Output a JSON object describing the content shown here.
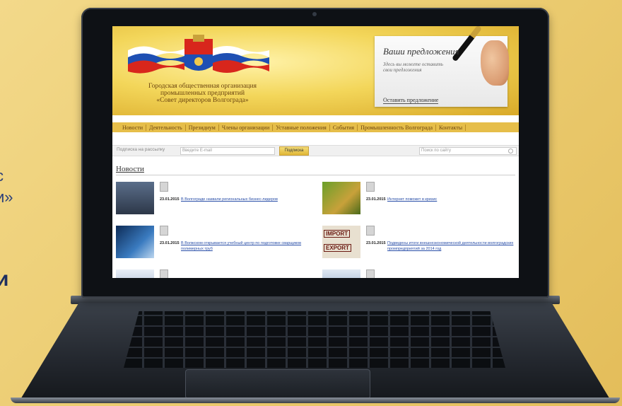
{
  "background_text": {
    "line1": "с",
    "line2": "и»",
    "line3": "и"
  },
  "site": {
    "org_title": [
      "Городская общественная организация",
      "промышленных предприятий",
      "«Совет директоров Волгограда»"
    ],
    "suggestion": {
      "title": "Ваши предложения",
      "subtitle": "Здесь вы можете оставить свои предложения",
      "link": "Оставить предложение"
    },
    "nav": [
      "Новости",
      "Деятельность",
      "Президиум",
      "Члены организации",
      "Уставные положения",
      "События",
      "Промышленность Волгограда",
      "Контакты"
    ],
    "subscribe": {
      "label": "Подписка на рассылку",
      "email_placeholder": "Введите E-mail",
      "button": "Подписка",
      "search_placeholder": "Поиск по сайту"
    },
    "news_heading": "Новости",
    "news": [
      {
        "date": "23.01.2015",
        "title": "В Волгограде назвали региональных бизнес-лидеров"
      },
      {
        "date": "23.01.2015",
        "title": "Интернет поможет в кризис"
      },
      {
        "date": "23.01.2015",
        "title": "В Волжском открывается учебный центр по подготовке сварщиков полимерных труб"
      },
      {
        "date": "23.01.2015",
        "title": "Подведены итоги внешнеэкономической деятельности волгоградских промпредприятий за 2014 год"
      },
      {
        "date": "",
        "title": ""
      },
      {
        "date": "",
        "title": ""
      }
    ],
    "stamps": {
      "import": "IMPORT",
      "export": "EXPORT"
    }
  }
}
